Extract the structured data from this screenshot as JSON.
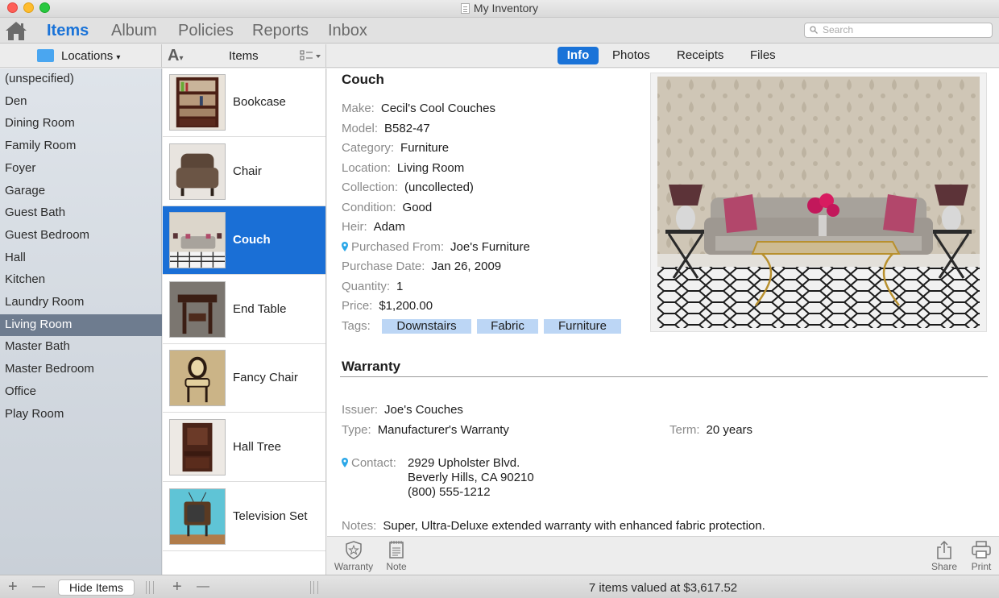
{
  "window": {
    "title": "My Inventory"
  },
  "nav": {
    "tabs": [
      {
        "label": "Items",
        "active": true
      },
      {
        "label": "Album"
      },
      {
        "label": "Policies"
      },
      {
        "label": "Reports"
      },
      {
        "label": "Inbox"
      }
    ],
    "search_placeholder": "Search"
  },
  "locations": {
    "header": "Locations",
    "items": [
      "(unspecified)",
      "Den",
      "Dining Room",
      "Family Room",
      "Foyer",
      "Garage",
      "Guest Bath",
      "Guest Bedroom",
      "Hall",
      "Kitchen",
      "Laundry Room",
      "Living Room",
      "Master Bath",
      "Master Bedroom",
      "Office",
      "Play Room"
    ],
    "selected": "Living Room"
  },
  "items": {
    "header": "Items",
    "sort_label": "A",
    "rows": [
      "Bookcase",
      "Chair",
      "Couch",
      "End Table",
      "Fancy Chair",
      "Hall Tree",
      "Television Set"
    ],
    "selected": "Couch"
  },
  "detail_tabs": [
    "Info",
    "Photos",
    "Receipts",
    "Files"
  ],
  "detail": {
    "title": "Couch",
    "fields": {
      "make": {
        "label": "Make:",
        "value": "Cecil's Cool Couches"
      },
      "model": {
        "label": "Model:",
        "value": "B582-47"
      },
      "category": {
        "label": "Category:",
        "value": "Furniture"
      },
      "location": {
        "label": "Location:",
        "value": "Living Room"
      },
      "collection": {
        "label": "Collection:",
        "value": "(uncollected)"
      },
      "condition": {
        "label": "Condition:",
        "value": "Good"
      },
      "heir": {
        "label": "Heir:",
        "value": "Adam"
      },
      "purchased_from": {
        "label": "Purchased From:",
        "value": "Joe's Furniture"
      },
      "purchase_date": {
        "label": "Purchase Date:",
        "value": "Jan 26, 2009"
      },
      "quantity": {
        "label": "Quantity:",
        "value": "1"
      },
      "price": {
        "label": "Price:",
        "value": "$1,200.00"
      },
      "tags_label": "Tags:"
    },
    "tags": [
      "Downstairs",
      "Fabric",
      "Furniture"
    ]
  },
  "warranty": {
    "title": "Warranty",
    "issuer": {
      "label": "Issuer:",
      "value": "Joe's Couches"
    },
    "type": {
      "label": "Type:",
      "value": "Manufacturer's Warranty"
    },
    "term": {
      "label": "Term:",
      "value": "20 years"
    },
    "contact": {
      "label": "Contact:",
      "lines": [
        "2929 Upholster Blvd.",
        "Beverly Hills, CA 90210",
        "(800) 555-1212"
      ]
    },
    "notes": {
      "label": "Notes:",
      "value": "Super, Ultra-Deluxe extended warranty with enhanced fabric protection."
    }
  },
  "actions": {
    "warranty": "Warranty",
    "note": "Note",
    "share": "Share",
    "print": "Print"
  },
  "status": {
    "text": "7 items valued at $3,617.52",
    "hide_items": "Hide Items",
    "add": "+",
    "remove": "—"
  },
  "colors": {
    "accent": "#1a73d8",
    "selection": "#1a6fd6",
    "sidebar_selected": "#6e7c8f",
    "tag": "#bcd6f5"
  }
}
